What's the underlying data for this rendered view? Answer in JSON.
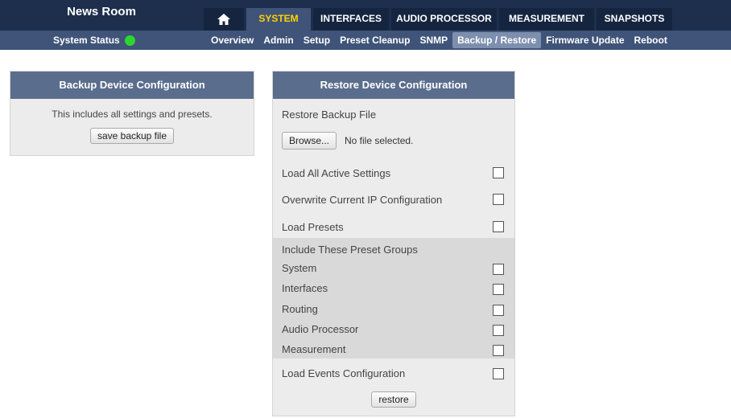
{
  "header": {
    "title": "News Room",
    "tabs": [
      {
        "label": "",
        "icon": "home-icon"
      },
      {
        "label": "SYSTEM",
        "active": true
      },
      {
        "label": "INTERFACES"
      },
      {
        "label": "AUDIO PROCESSOR"
      },
      {
        "label": "MEASUREMENT"
      },
      {
        "label": "SNAPSHOTS"
      }
    ]
  },
  "subnav": {
    "status_label": "System Status",
    "status_color": "#2fd52f",
    "items": [
      {
        "label": "Overview"
      },
      {
        "label": "Admin"
      },
      {
        "label": "Setup"
      },
      {
        "label": "Preset Cleanup"
      },
      {
        "label": "SNMP"
      },
      {
        "label": "Backup / Restore",
        "active": true
      },
      {
        "label": "Firmware Update"
      },
      {
        "label": "Reboot"
      }
    ]
  },
  "backup": {
    "title": "Backup Device Configuration",
    "description": "This includes all settings and presets.",
    "button": "save backup file"
  },
  "restore": {
    "title": "Restore Device Configuration",
    "file_label": "Restore Backup File",
    "browse_button": "Browse...",
    "file_status": "No file selected.",
    "options": [
      {
        "label": "Load All Active Settings",
        "checked": false
      },
      {
        "label": "Overwrite Current IP Configuration",
        "checked": false
      },
      {
        "label": "Load Presets",
        "checked": false
      }
    ],
    "groups_heading": "Include These Preset Groups",
    "groups": [
      {
        "label": "System",
        "checked": false
      },
      {
        "label": "Interfaces",
        "checked": false
      },
      {
        "label": "Routing",
        "checked": false
      },
      {
        "label": "Audio Processor",
        "checked": false
      },
      {
        "label": "Measurement",
        "checked": false
      }
    ],
    "events_label": "Load Events Configuration",
    "events_checked": false,
    "button": "restore"
  }
}
